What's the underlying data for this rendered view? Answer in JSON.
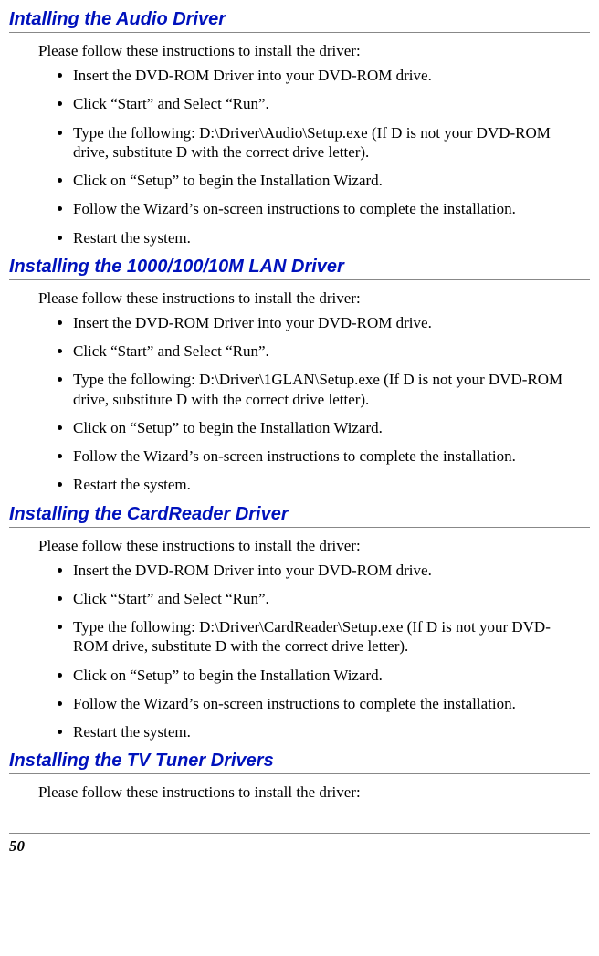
{
  "sections": [
    {
      "heading": "Intalling the Audio Driver",
      "intro": "Please follow these instructions to install the driver:",
      "items": [
        "Insert the DVD-ROM Driver into your DVD-ROM drive.",
        "Click “Start” and Select “Run”.",
        "Type the following: D:\\Driver\\Audio\\Setup.exe (If D is not your DVD-ROM drive, substitute D with the correct drive letter).",
        "Click on “Setup” to begin the Installation Wizard.",
        "Follow the Wizard’s on-screen instructions to complete the installation.",
        "Restart the system."
      ]
    },
    {
      "heading": "Installing the 1000/100/10M LAN Driver",
      "intro": "Please follow these instructions to install the driver:",
      "items": [
        "Insert the DVD-ROM Driver into your DVD-ROM drive.",
        "Click “Start” and Select “Run”.",
        "Type the following: D:\\Driver\\1GLAN\\Setup.exe (If D is not your DVD-ROM drive, substitute D with the correct drive letter).",
        "Click on “Setup” to begin the Installation Wizard.",
        "Follow the Wizard’s on-screen instructions to complete the installation.",
        "Restart the system."
      ]
    },
    {
      "heading": "Installing the CardReader Driver",
      "intro": "Please follow these instructions to install the driver:",
      "items": [
        "Insert the DVD-ROM Driver into your DVD-ROM drive.",
        "Click “Start” and Select “Run”.",
        "Type the following: D:\\Driver\\CardReader\\Setup.exe (If D is not your DVD-ROM drive, substitute D with the correct drive letter).",
        "Click on “Setup” to begin the Installation Wizard.",
        "Follow the Wizard’s on-screen instructions to complete the installation.",
        "Restart the system."
      ]
    },
    {
      "heading": "Installing the TV Tuner Drivers",
      "intro": "Please follow these instructions to install the driver:",
      "items": []
    }
  ],
  "pageNumber": "50"
}
